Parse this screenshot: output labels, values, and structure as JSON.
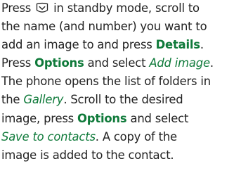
{
  "paragraph": {
    "l1_a": "Press",
    "l1_icon": "scroll-down-key-icon",
    "l1_b": "in standby mode, scroll to",
    "l2": "the name (and number) you want to",
    "l3_a": "add an image to and press",
    "l3_details": "Details",
    "l3_end": ".",
    "l4_a": "Press",
    "l4_options": "Options",
    "l4_b": "and select",
    "l4_add_image": "Add image",
    "l4_end": ".",
    "l5": "The phone opens the list of folders in",
    "l6_a": "the",
    "l6_gallery": "Gallery",
    "l6_b": ". Scroll to the desired",
    "l7_a": "image, press",
    "l7_options": "Options",
    "l7_b": "and select",
    "l8_save": "Save to contacts",
    "l8_b": ". A copy of the",
    "l9": "image is added to the contact."
  },
  "colors": {
    "text": "#222222",
    "accent": "#0f7a3a"
  }
}
